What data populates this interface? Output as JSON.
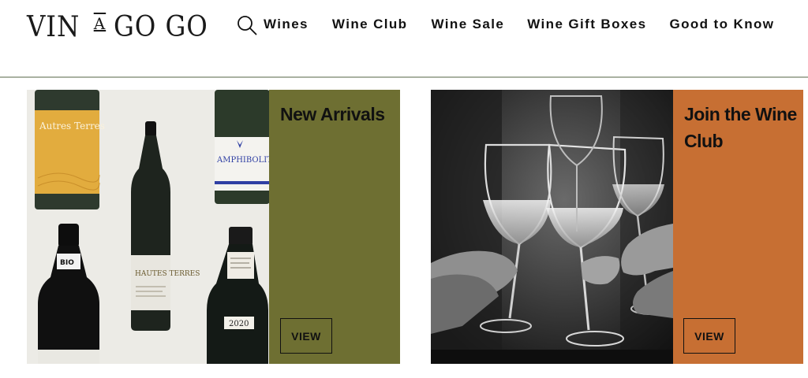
{
  "header": {
    "logo": {
      "part1": "VIN",
      "part2": "A",
      "part3": "GO GO"
    },
    "nav": [
      {
        "label": "Wines"
      },
      {
        "label": "Wine Club"
      },
      {
        "label": "Wine Sale"
      },
      {
        "label": "Wine Gift Boxes"
      },
      {
        "label": "Good to Know"
      }
    ]
  },
  "cards": [
    {
      "title": "New Arrivals",
      "button": "VIEW",
      "bottle_labels": [
        "Autres Terres",
        "AMPHIBOLITE",
        "BIO",
        "HAUTES TERRES",
        "2020"
      ]
    },
    {
      "title": "Join the Wine Club",
      "button": "VIEW"
    }
  ],
  "colors": {
    "card1_panel": "#6e6f32",
    "card2_panel": "#c76f33",
    "header_rule": "#aab2a2"
  }
}
